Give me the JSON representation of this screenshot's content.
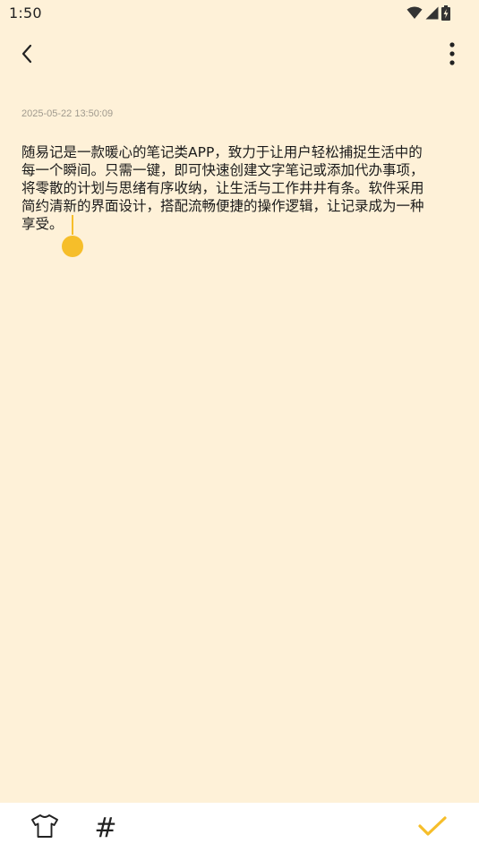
{
  "status_bar": {
    "time": "1:50",
    "icons": [
      "wifi-icon",
      "signal-icon",
      "battery-charging-icon"
    ]
  },
  "toolbar": {
    "back_icon": "chevron-left-icon",
    "more_icon": "more-vertical-icon"
  },
  "note": {
    "timestamp": "2025-05-22 13:50:09",
    "lines": [
      "随易记是一款暖心的笔记类APP，致力于让用户轻松捕捉生活中的",
      "每一个瞬间。只需一键，即可快速创建文字笔记或添加代办事项，",
      "将零散的计划与思绪有序收纳，让生活与工作井井有条。软件采用",
      "简约清新的界面设计，搭配流畅便捷的操作逻辑，让记录成为一种",
      "享受。"
    ]
  },
  "bottom_bar": {
    "theme_icon": "tshirt-icon",
    "tag_label": "#",
    "confirm_icon": "checkmark-icon"
  },
  "colors": {
    "background": "#FEF1D8",
    "accent": "#F6BE2A",
    "bottom_bar": "#FFFFFF"
  }
}
